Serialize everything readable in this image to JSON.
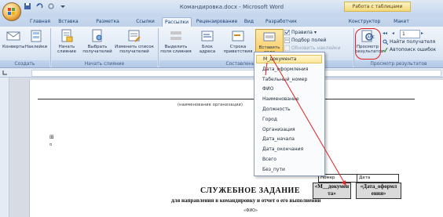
{
  "window": {
    "document_title": "Командировка.docx - Microsoft Word",
    "context_tab_title": "Работа с таблицами"
  },
  "tabs": [
    {
      "label": "Главная"
    },
    {
      "label": "Вставка"
    },
    {
      "label": "Разметка страницы"
    },
    {
      "label": "Ссылки"
    },
    {
      "label": "Рассылки"
    },
    {
      "label": "Рецензирование"
    },
    {
      "label": "Вид"
    },
    {
      "label": "Разработчик"
    },
    {
      "label": "Конструктор"
    },
    {
      "label": "Макет"
    }
  ],
  "ribbon": {
    "create": {
      "envelopes": "Конверты",
      "labels": "Наклейки",
      "group": "Создать"
    },
    "start_merge": {
      "start": "Начать слияние",
      "select": "Выбрать получателей",
      "edit": "Изменить список получателей",
      "group": "Начать слияние"
    },
    "write_insert": {
      "highlight": "Выделить поля слияния",
      "address": "Блок адреса",
      "greeting": "Строка приветствия",
      "insert_field": "Вставить поле слияния",
      "rules": "Правила",
      "match": "Подбор полей",
      "update": "Обновить наклейки",
      "group": "Составление документа"
    },
    "preview": {
      "preview_results": "Просмотр результатов",
      "record_value": "1",
      "find": "Найти получателя",
      "auto_check": "Автопоиск ошибок",
      "group": "Просмотр результатов"
    }
  },
  "dropdown": {
    "items": [
      "М_документа",
      "Дата_оформления",
      "Табельный_номер",
      "ФИО",
      "Наименование",
      "Должность",
      "Город",
      "Организация",
      "Дата_начала",
      "Дата_окончания",
      "Всего",
      "Без_пути"
    ],
    "hovered_index": 0
  },
  "document": {
    "small_text": "(наименование организации)",
    "header_cells": {
      "number": "Номер документа",
      "date": "Дата составления"
    },
    "field_cells": {
      "number": "«М__докумен та»",
      "date": "«Дата_оформл ения»"
    },
    "title": "СЛУЖЕБНОЕ ЗАДАНИЕ",
    "subtitle": "для направления в командировку и отчет о его выполнении",
    "fio": "«ФИО»"
  },
  "colors": {
    "annotation": "#e02020",
    "hover_fill": "#fde59a",
    "ribbon_bg": "#dbe6f4"
  }
}
